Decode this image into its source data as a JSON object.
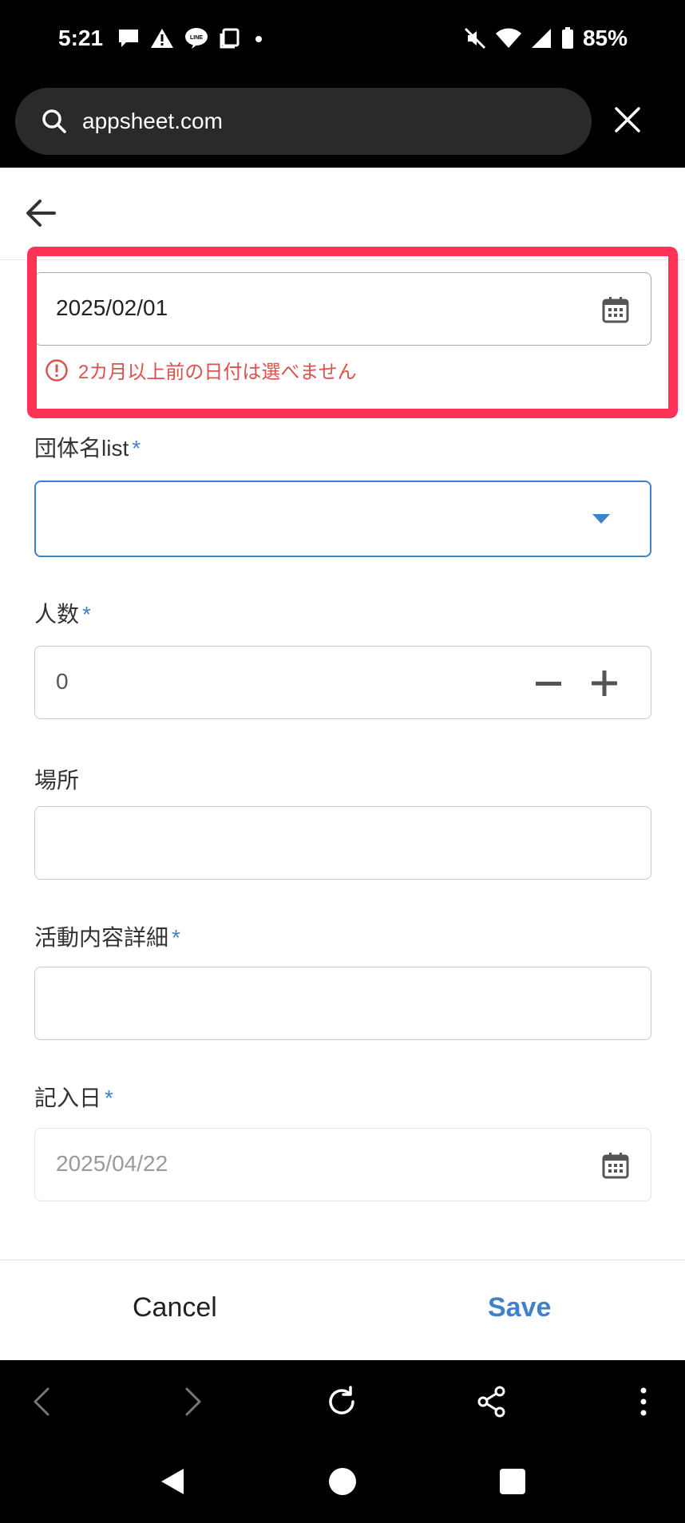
{
  "status_bar": {
    "time": "5:21",
    "battery": "85%",
    "left_icons": [
      "chat-bubble-icon",
      "warning-icon",
      "line-app-icon",
      "square-icon",
      "dot-icon"
    ],
    "right_icons": [
      "mute-icon",
      "wifi-icon",
      "signal-icon",
      "battery-icon"
    ]
  },
  "browser": {
    "url": "appsheet.com"
  },
  "form": {
    "date_field": {
      "value": "2025/02/01",
      "error": "2カ月以上前の日付は選べません"
    },
    "group_field": {
      "label": "団体名list",
      "required_mark": "*",
      "value": ""
    },
    "count_field": {
      "label": "人数",
      "required_mark": "*",
      "value": "0"
    },
    "place_field": {
      "label": "場所",
      "value": ""
    },
    "detail_field": {
      "label": "活動内容詳細",
      "required_mark": "*",
      "value": ""
    },
    "entry_date_field": {
      "label": "記入日",
      "required_mark": "*",
      "value": "2025/04/22"
    }
  },
  "actions": {
    "cancel": "Cancel",
    "save": "Save"
  },
  "colors": {
    "accent": "#3f82c9",
    "error": "#d9534f",
    "highlight": "#ff3355"
  }
}
